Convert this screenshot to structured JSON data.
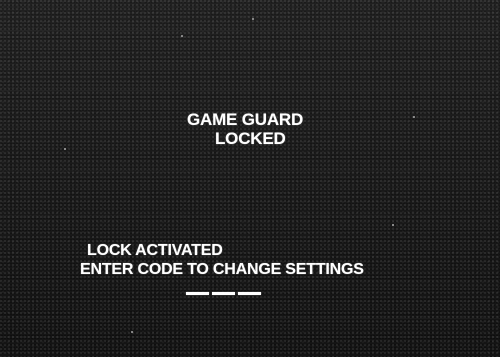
{
  "screen": {
    "title_line1": "GAME GUARD",
    "title_line2": "LOCKED",
    "status": "LOCK ACTIVATED",
    "prompt": "ENTER CODE TO CHANGE SETTINGS",
    "code_slots": 3
  },
  "colors": {
    "background": "#141414",
    "text": "#ffffff"
  }
}
